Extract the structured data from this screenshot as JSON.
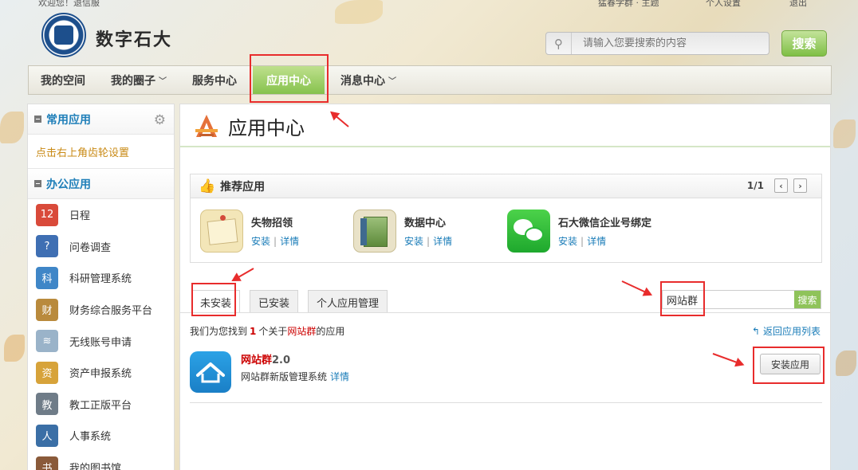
{
  "topbar": {
    "left": "欢迎您！退信服",
    "right": [
      "猛春学群 · 主题",
      "个人设置",
      "退出"
    ]
  },
  "site": {
    "name": "数字石大"
  },
  "search": {
    "placeholder": "请输入您要搜索的内容",
    "button": "搜索"
  },
  "nav": {
    "items": [
      {
        "label": "我的空间"
      },
      {
        "label": "我的圈子",
        "caret": "﹀"
      },
      {
        "label": "服务中心"
      },
      {
        "label": "应用中心"
      },
      {
        "label": "消息中心",
        "caret": "﹀"
      }
    ]
  },
  "sidebar": {
    "common_title": "常用应用",
    "common_tip": "点击右上角齿轮设置",
    "office_title": "办公应用",
    "apps": [
      {
        "label": "日程",
        "color": "#d94a3a",
        "glyph": "12"
      },
      {
        "label": "问卷调查",
        "color": "#3f6fb3",
        "glyph": "?"
      },
      {
        "label": "科研管理系统",
        "color": "#3f86c7",
        "glyph": "科"
      },
      {
        "label": "财务综合服务平台",
        "color": "#b98a3c",
        "glyph": "财"
      },
      {
        "label": "无线账号申请",
        "color": "#9ab3c9",
        "glyph": "≋"
      },
      {
        "label": "资产申报系统",
        "color": "#d7a33a",
        "glyph": "资"
      },
      {
        "label": "教工正版平台",
        "color": "#6f7c88",
        "glyph": "教"
      },
      {
        "label": "人事系统",
        "color": "#3b6fa6",
        "glyph": "人"
      },
      {
        "label": "我的图书馆",
        "color": "#8a5a3a",
        "glyph": "书"
      }
    ]
  },
  "main": {
    "title": "应用中心",
    "recommend": {
      "title": "推荐应用",
      "pager": "1/1",
      "items": [
        {
          "name": "失物招领",
          "install": "安装",
          "detail": "详情",
          "color": "#f1dfa8"
        },
        {
          "name": "数据中心",
          "install": "安装",
          "detail": "详情",
          "color": "#8fb05a"
        },
        {
          "name": "石大微信企业号绑定",
          "install": "安装",
          "detail": "详情",
          "color": "#2aa838"
        }
      ]
    },
    "tabs": [
      {
        "label": "未安装"
      },
      {
        "label": "已安装"
      },
      {
        "label": "个人应用管理"
      }
    ],
    "filter": {
      "value": "网站群",
      "button": "搜索"
    },
    "result": {
      "prefix": "我们为您找到",
      "count": "1",
      "mid": "个关于",
      "keyword": "网站群",
      "suffix": "的应用"
    },
    "back": "返回应用列表",
    "app": {
      "name": "网站群",
      "version": "2.0",
      "desc": "网站群新版管理系统",
      "detail": "详情",
      "install": "安装应用"
    }
  },
  "colors": {
    "accent_green": "#86c24d",
    "link_blue": "#1a7cb8",
    "annotation_red": "#e82c2c"
  }
}
